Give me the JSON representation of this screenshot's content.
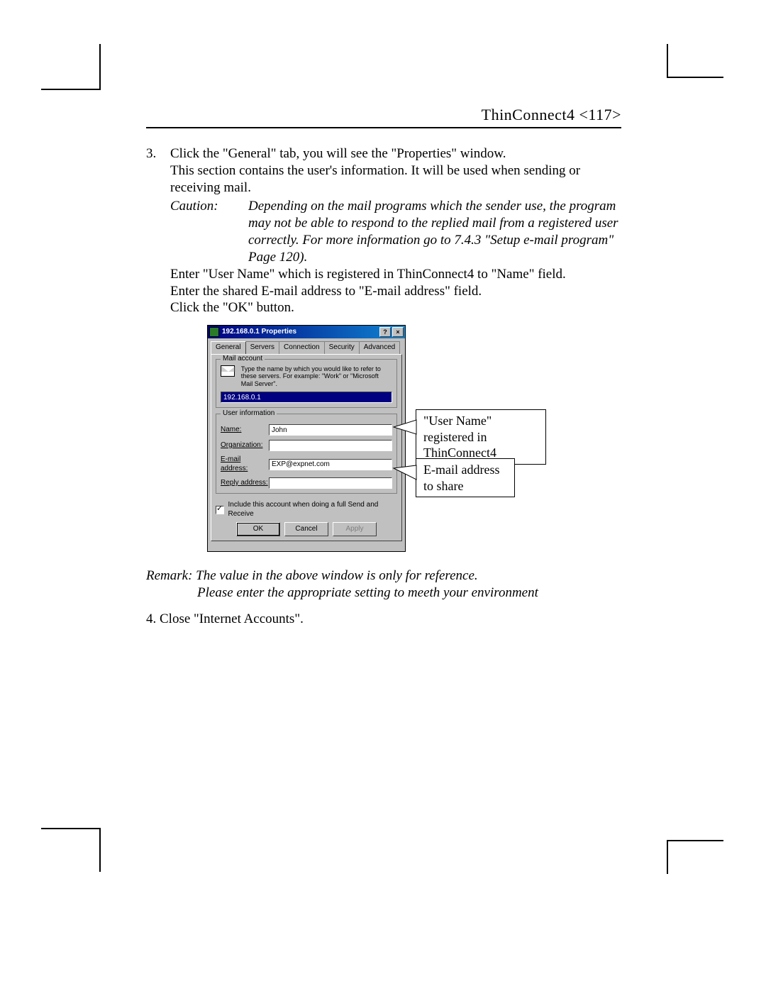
{
  "header": {
    "product": "ThinConnect4",
    "page_num": "<117>"
  },
  "step3": {
    "num": "3.",
    "line1": "Click the \"General\" tab, you will see the \"Properties\" window.",
    "line2": "This section contains the user's information. It will be used when sending or receiving mail.",
    "caution_label": "Caution:",
    "caution_text": "Depending on the mail programs which the sender use, the program may not be able to respond to the replied mail from a registered user correctly.  For more information go to 7.4.3 \"Setup e-mail program\" Page 120).",
    "line3": "Enter \"User Name\" which is registered in ThinConnect4 to \"Name\" field.",
    "line4": "Enter the shared E-mail address to \"E-mail address\" field.",
    "line5": "Click the \"OK\" button."
  },
  "dialog": {
    "title": "192.168.0.1 Properties",
    "sys_help": "?",
    "sys_close": "×",
    "tabs": [
      "General",
      "Servers",
      "Connection",
      "Security",
      "Advanced"
    ],
    "active_tab": "General",
    "mail_account": {
      "legend": "Mail account",
      "hint": "Type the name by which you would like to refer to these servers. For example: \"Work\" or \"Microsoft Mail Server\".",
      "value": "192.168.0.1"
    },
    "user_info": {
      "legend": "User information",
      "name_label": "Name:",
      "name_value": "John",
      "org_label": "Organization:",
      "org_value": "",
      "email_label": "E-mail address:",
      "email_value": "EXP@expnet.com",
      "reply_label": "Reply address:",
      "reply_value": ""
    },
    "checkbox_label": "Include this account when doing a full Send and Receive",
    "buttons": {
      "ok": "OK",
      "cancel": "Cancel",
      "apply": "Apply"
    }
  },
  "callouts": {
    "c1_l1": "\"User Name\"",
    "c1_l2": "registered in ThinConnect4",
    "c2_l1": "E-mail address",
    "c2_l2": "to share"
  },
  "remark": {
    "l1": "Remark: The value in the above window is only for reference.",
    "l2": "Please enter the appropriate setting to meeth your environment"
  },
  "step4": {
    "text": "4. Close \"Internet Accounts\"."
  }
}
